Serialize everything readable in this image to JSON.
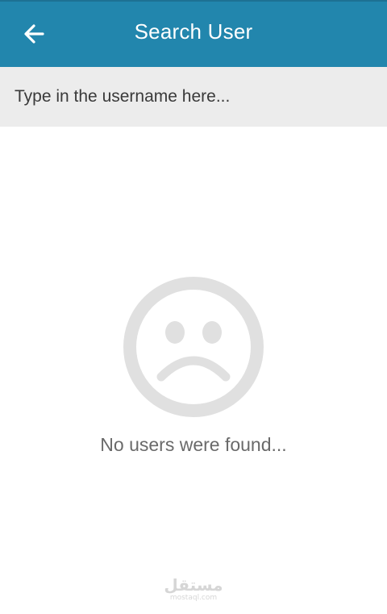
{
  "app_bar": {
    "title": "Search User",
    "back_icon": "arrow-left-icon",
    "background_color": "#2286ad"
  },
  "search": {
    "placeholder": "Type in the username here...",
    "value": "",
    "background_color": "#ececec"
  },
  "empty_state": {
    "icon": "sad-face-icon",
    "message": "No users were found...",
    "icon_color": "#e0e0e0"
  },
  "watermark": {
    "main": "مستقل",
    "sub": "mostaql.com"
  }
}
